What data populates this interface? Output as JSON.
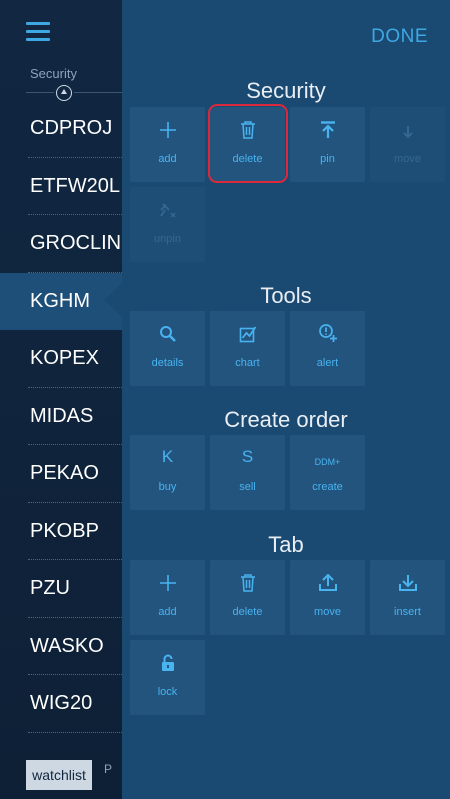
{
  "left": {
    "security_header": "Security",
    "rows": [
      "CDPROJ",
      "ETFW20L",
      "GROCLIN",
      "KGHM",
      "KOPEX",
      "MIDAS",
      "PEKAO",
      "PKOBP",
      "PZU",
      "WASKO",
      "WIG20"
    ],
    "selected": "KGHM",
    "tabs": {
      "watchlist": "watchlist",
      "next": "P"
    }
  },
  "panel": {
    "done_label": "DONE",
    "sections": {
      "security": {
        "title": "Security",
        "add": "add",
        "delete": "delete",
        "pin": "pin",
        "move": "move",
        "unpin": "unpin"
      },
      "tools": {
        "title": "Tools",
        "details": "details",
        "chart": "chart",
        "alert": "alert"
      },
      "create_order": {
        "title": "Create order",
        "buy_icon": "K",
        "buy": "buy",
        "sell_icon": "S",
        "sell": "sell",
        "create_icon": "DDM+",
        "create": "create"
      },
      "tab": {
        "title": "Tab",
        "add": "add",
        "delete": "delete",
        "move": "move",
        "insert": "insert",
        "lock": "lock"
      }
    }
  },
  "colors": {
    "accent": "#3ea8e4",
    "panel": "#1a4a72",
    "tile": "#23547d",
    "highlight": "#d9293b",
    "sidebar": "#112742"
  }
}
